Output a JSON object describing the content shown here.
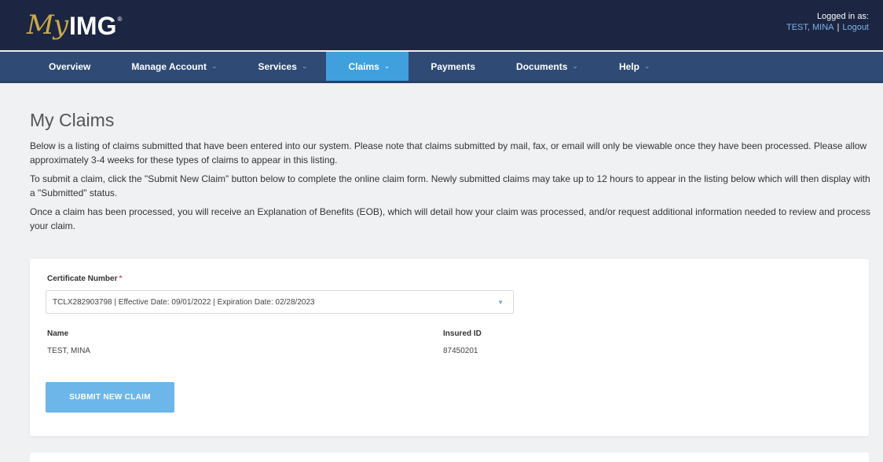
{
  "header": {
    "logo_my": "My",
    "logo_img": "IMG",
    "logo_reg": "®",
    "logged_in_label": "Logged in as:",
    "user_name": "TEST, MINA",
    "separator": "|",
    "logout_label": "Logout"
  },
  "nav": {
    "items": [
      {
        "label": "Overview",
        "has_dropdown": false
      },
      {
        "label": "Manage Account",
        "has_dropdown": true
      },
      {
        "label": "Services",
        "has_dropdown": true
      },
      {
        "label": "Claims",
        "has_dropdown": true,
        "active": true
      },
      {
        "label": "Payments",
        "has_dropdown": false
      },
      {
        "label": "Documents",
        "has_dropdown": true
      },
      {
        "label": "Help",
        "has_dropdown": true
      }
    ],
    "chevron_icon": "chevron-down-icon"
  },
  "main": {
    "title": "My Claims",
    "paragraphs": [
      "Below is a listing of claims submitted that have been entered into our system. Please note that claims submitted by mail, fax, or email will only be viewable once they have been processed. Please allow approximately 3-4 weeks for these types of claims to appear in this listing.",
      "To submit a claim, click the \"Submit New Claim\" button below to complete the online claim form. Newly submitted claims may take up to 12 hours to appear in the listing below which will then display with a \"Submitted\" status.",
      "Once a claim has been processed, you will receive an Explanation of Benefits (EOB), which will detail how your claim was processed, and/or request additional information needed to review and process your claim."
    ]
  },
  "claim_form": {
    "certificate_label": "Certificate Number",
    "required_marker": "*",
    "certificate_value": "TCLX282903798 | Effective Date: 09/01/2022 | Expiration Date: 02/28/2023",
    "name_label": "Name",
    "name_value": "TEST, MINA",
    "insured_id_label": "Insured ID",
    "insured_id_value": "87450201",
    "submit_label": "SUBMIT NEW CLAIM"
  },
  "colors": {
    "header_bg": "#1c2541",
    "nav_bg": "#2e4a75",
    "nav_active": "#3fa0dd",
    "button": "#6db6ea",
    "link": "#7fb3e8",
    "logo_gold": "#c9a94a"
  }
}
